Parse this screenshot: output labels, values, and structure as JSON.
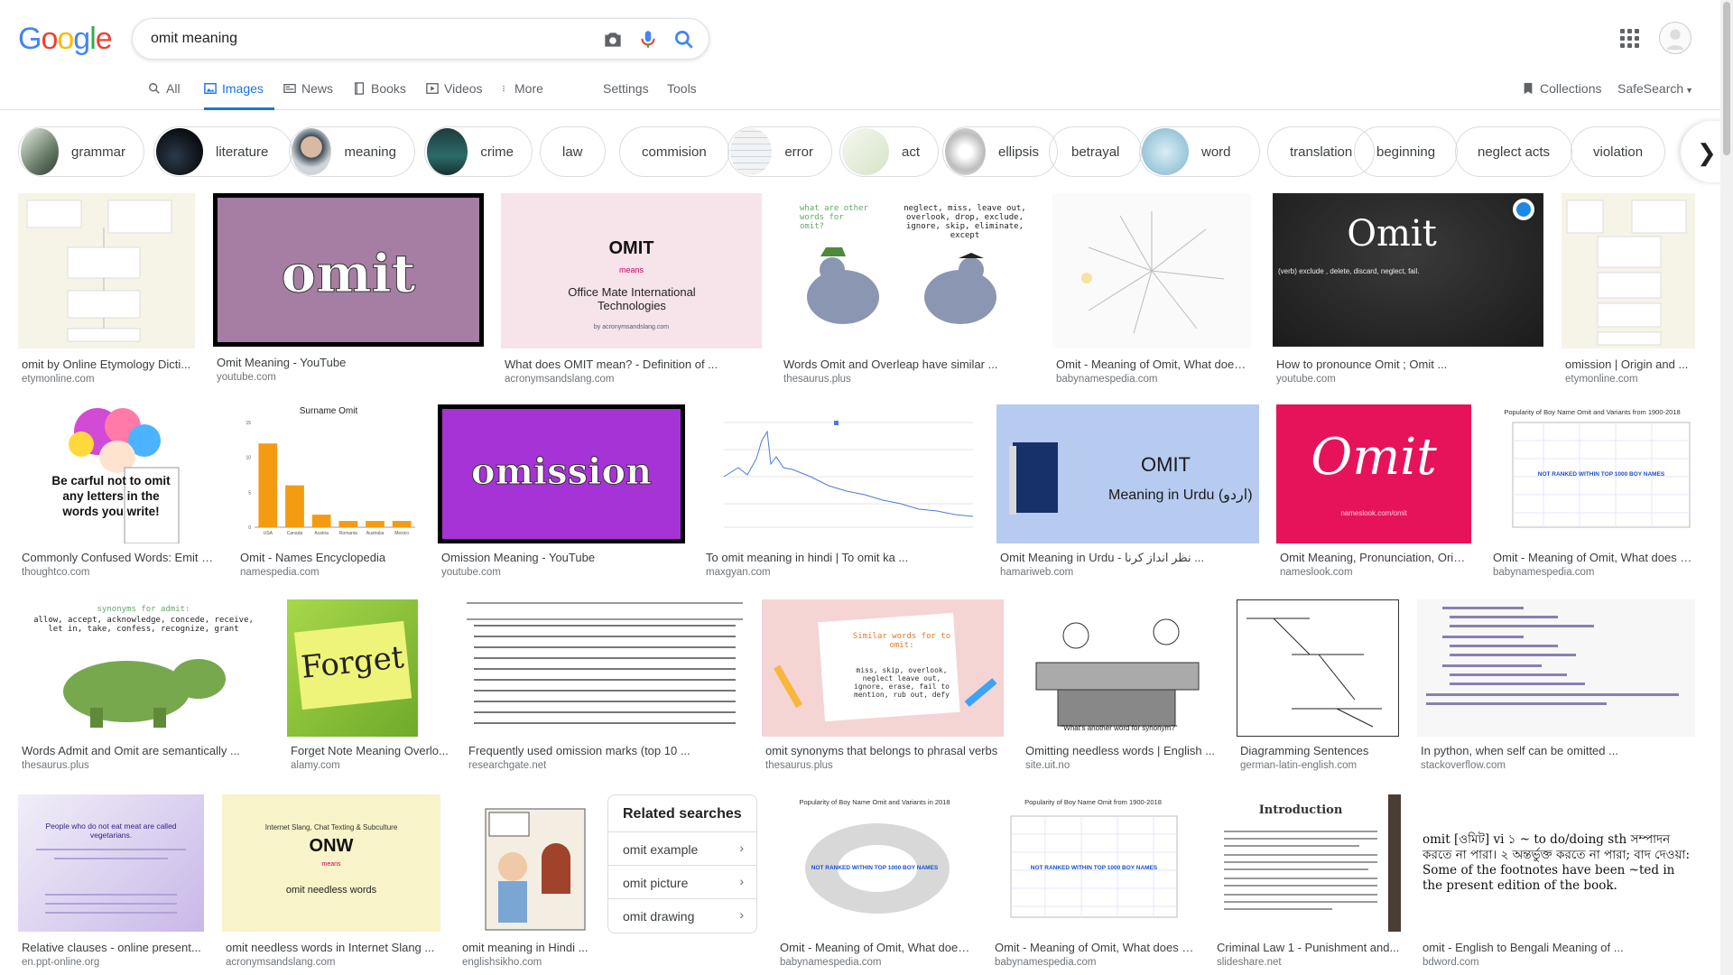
{
  "search": {
    "query": "omit meaning"
  },
  "tabs": [
    {
      "label": "All",
      "icon": "search-icon"
    },
    {
      "label": "Images",
      "icon": "image-icon"
    },
    {
      "label": "News",
      "icon": "news-icon"
    },
    {
      "label": "Books",
      "icon": "book-icon"
    },
    {
      "label": "Videos",
      "icon": "video-icon"
    },
    {
      "label": "More",
      "icon": "more-vert-icon"
    }
  ],
  "tools": {
    "settings": "Settings",
    "tools": "Tools",
    "collections": "Collections",
    "safesearch": "SafeSearch"
  },
  "chips": [
    "grammar",
    "literature",
    "meaning",
    "crime",
    "law",
    "commision",
    "error",
    "act",
    "ellipsis",
    "betrayal",
    "word",
    "translation",
    "beginning",
    "neglect acts",
    "violation"
  ],
  "results": [
    {
      "caption": "omit by Online Etymology Dicti...",
      "source": "etymonline.com"
    },
    {
      "caption": "Omit Meaning - YouTube",
      "source": "youtube.com",
      "img_text": "omit"
    },
    {
      "caption": "What does OMIT mean? - Definition of ...",
      "source": "acronymsandslang.com",
      "img_title": "OMIT",
      "img_means": "means",
      "img_sub": "Office Mate International Technologies",
      "img_by": "by acronymsandslang.com"
    },
    {
      "caption": "Words Omit and Overleap have similar ...",
      "source": "thesaurus.plus",
      "img_q": "what are other words for omit?",
      "img_words": "neglect, miss, leave out, overlook, drop, exclude, ignore, skip, eliminate, except"
    },
    {
      "caption": "Omit - Meaning of Omit, What does ...",
      "source": "babynamespedia.com"
    },
    {
      "caption": "How to pronounce Omit ; Omit ...",
      "source": "youtube.com",
      "img_title": "Omit",
      "img_sub": "(verb) exclude , delete, discard, neglect, fail."
    },
    {
      "caption": "omission | Origin and ...",
      "source": "etymonline.com"
    },
    {
      "caption": "Commonly Confused Words: Emit a...",
      "source": "thoughtco.com",
      "img_text": "Be carful not to omit any letters in the words you write!"
    },
    {
      "caption": "Omit - Names Encyclopedia",
      "source": "namespedia.com",
      "img_title": "Surname Omit"
    },
    {
      "caption": "Omission Meaning - YouTube",
      "source": "youtube.com",
      "img_text": "omission"
    },
    {
      "caption": "To omit meaning in hindi | To omit ka ...",
      "source": "maxgyan.com"
    },
    {
      "caption": "Omit Meaning in Urdu - نظر انداز کرنا ...",
      "source": "hamariweb.com",
      "img_title": "OMIT",
      "img_sub": "Meaning in Urdu (اردو)"
    },
    {
      "caption": "Omit Meaning, Pronunciation, Origi...",
      "source": "nameslook.com",
      "img_text": "Omit",
      "img_sub": "nameslook.com/omit"
    },
    {
      "caption": "Omit - Meaning of Omit, What does O...",
      "source": "babynamespedia.com",
      "img_title": "Popularity of Boy Name Omit and Variants from 1900-2018",
      "img_sub": "NOT RANKED WITHIN TOP 1000 BOY NAMES"
    },
    {
      "caption": "Words Admit and Omit are semantically ...",
      "source": "thesaurus.plus",
      "img_title": "synonyms for admit:",
      "img_sub": "allow, accept, acknowledge, concede, receive, let in, take, confess, recognize, grant"
    },
    {
      "caption": "Forget Note Meaning Overlo...",
      "source": "alamy.com",
      "img_text": "Forget"
    },
    {
      "caption": "Frequently used omission marks (top 10 ...",
      "source": "researchgate.net"
    },
    {
      "caption": "omit synonyms that belongs to phrasal verbs",
      "source": "thesaurus.plus",
      "img_title": "Similar words for to omit:",
      "img_sub": "miss, skip, overlook, neglect leave out, ignore, erase, fail to mention, rub out, defy"
    },
    {
      "caption": "Omitting needless words | English ...",
      "source": "site.uit.no",
      "img_sub": "\"What's another word for synonym?\""
    },
    {
      "caption": "Diagramming Sentences",
      "source": "german-latin-english.com"
    },
    {
      "caption": "In python, when self can be omitted ...",
      "source": "stackoverflow.com"
    },
    {
      "caption": "Relative clauses - online present...",
      "source": "en.ppt-online.org",
      "img_title": "People who do not eat meat are called vegetarians."
    },
    {
      "caption": "omit needless words in Internet Slang ...",
      "source": "acronymsandslang.com",
      "img_top": "Internet Slang, Chat Texting & Subculture",
      "img_title": "ONW",
      "img_means": "means",
      "img_sub": "omit needless words"
    },
    {
      "caption": "omit meaning in Hindi ...",
      "source": "englishsikho.com"
    },
    {
      "caption": "Omit - Meaning of Omit, What does...",
      "source": "babynamespedia.com",
      "img_title": "Popularity of Boy Name Omit and Variants in 2018",
      "img_sub": "NOT RANKED WITHIN TOP 1000 BOY NAMES"
    },
    {
      "caption": "Omit - Meaning of Omit, What does O...",
      "source": "babynamespedia.com",
      "img_title": "Popularity of Boy Name Omit from 1900-2018",
      "img_sub": "NOT RANKED WITHIN TOP 1000 BOY NAMES"
    },
    {
      "caption": "Criminal Law 1 - Punishment and...",
      "source": "slideshare.net",
      "img_title": "Introduction"
    },
    {
      "caption": "omit - English to Bengali Meaning of ...",
      "source": "bdword.com",
      "img_text": "omit [ওমিট] vi ১ ~ to do/doing sth সম্পাদন করতে না পারা। ২ অন্তর্ভুক্ত করতে না পারা; বাদ দেওয়া: Some of the footnotes have been ~ted in the present edition of the book."
    }
  ],
  "related": {
    "title": "Related searches",
    "items": [
      "omit example",
      "omit picture",
      "omit drawing"
    ]
  },
  "chart_data": {
    "type": "bar",
    "title": "Surname Omit",
    "categories": [
      "USA",
      "Canada",
      "Austria",
      "Romania",
      "Australia",
      "Mexico"
    ],
    "values": [
      12,
      6,
      1.8,
      0.9,
      0.9,
      0.9
    ],
    "ylim": [
      0,
      15
    ]
  },
  "colors": {
    "accent": "#1a73e8",
    "logo_blue": "#4285f4",
    "logo_red": "#ea4335",
    "logo_yellow": "#fbbc05",
    "logo_green": "#34a853"
  }
}
